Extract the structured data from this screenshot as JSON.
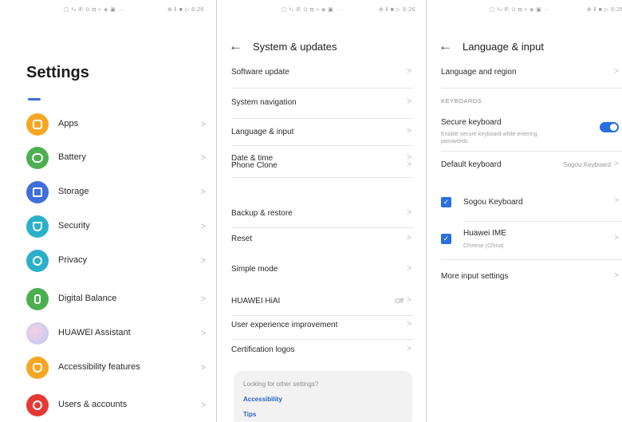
{
  "status": {
    "left": "▢ ᵃᵢₗ ✆ ⊙ ◘ ≈ ◈ ▣ ···",
    "right": "⊕ ‖ ■ ▷ 6:26"
  },
  "settings": {
    "title": "Settings",
    "items": [
      {
        "label": "Apps",
        "icon": "apps-icon",
        "color": "#f5a623"
      },
      {
        "label": "Battery",
        "icon": "battery-icon",
        "color": "#4caf50"
      },
      {
        "label": "Storage",
        "icon": "storage-icon",
        "color": "#3f6fd8"
      },
      {
        "label": "Security",
        "icon": "security-icon",
        "color": "#2bb0c9"
      },
      {
        "label": "Privacy",
        "icon": "privacy-icon",
        "color": "#2bb0c9"
      },
      {
        "label": "Digital Balance",
        "icon": "digital-balance-icon",
        "color": "#4caf50"
      },
      {
        "label": "HUAWEI Assistant",
        "icon": "huawei-assistant-icon",
        "color": "#e8a9c9"
      },
      {
        "label": "Accessibility features",
        "icon": "accessibility-icon",
        "color": "#f5a623"
      },
      {
        "label": "Users & accounts",
        "icon": "users-icon",
        "color": "#e53935"
      }
    ],
    "chevron": ">"
  },
  "system": {
    "title": "System & updates",
    "back": "←",
    "items": [
      {
        "label": "Software update"
      },
      {
        "label": "System navigation"
      },
      {
        "label": "Language & input"
      },
      {
        "label": "Date & time"
      },
      {
        "label": "Phone Clone"
      },
      {
        "label": "Backup & restore"
      },
      {
        "label": "Reset"
      },
      {
        "label": "Simple mode"
      },
      {
        "label": "HUAWEI HiAI",
        "value": "Off"
      },
      {
        "label": "User experience improvement"
      },
      {
        "label": "Certification logos"
      }
    ],
    "hint": {
      "title": "Looking for other settings?",
      "links": [
        "Accessibility",
        "Tips"
      ]
    }
  },
  "language": {
    "title": "Language & input",
    "back": "←",
    "language_region": "Language and region",
    "section": "KEYBOARDS",
    "secure_keyboard": {
      "label": "Secure keyboard",
      "desc_line1": "Enable secure keyboard while entering",
      "desc_line2": "passwords.",
      "on": true
    },
    "default_keyboard": {
      "label": "Default keyboard",
      "value": "Sogou Keyboard"
    },
    "keyboards": [
      {
        "label": "Sogou Keyboard",
        "checked": true,
        "sub": ""
      },
      {
        "label": "Huawei IME",
        "checked": true,
        "sub": "Chinese (China)"
      }
    ],
    "more": "More input settings",
    "check_glyph": "✓"
  }
}
